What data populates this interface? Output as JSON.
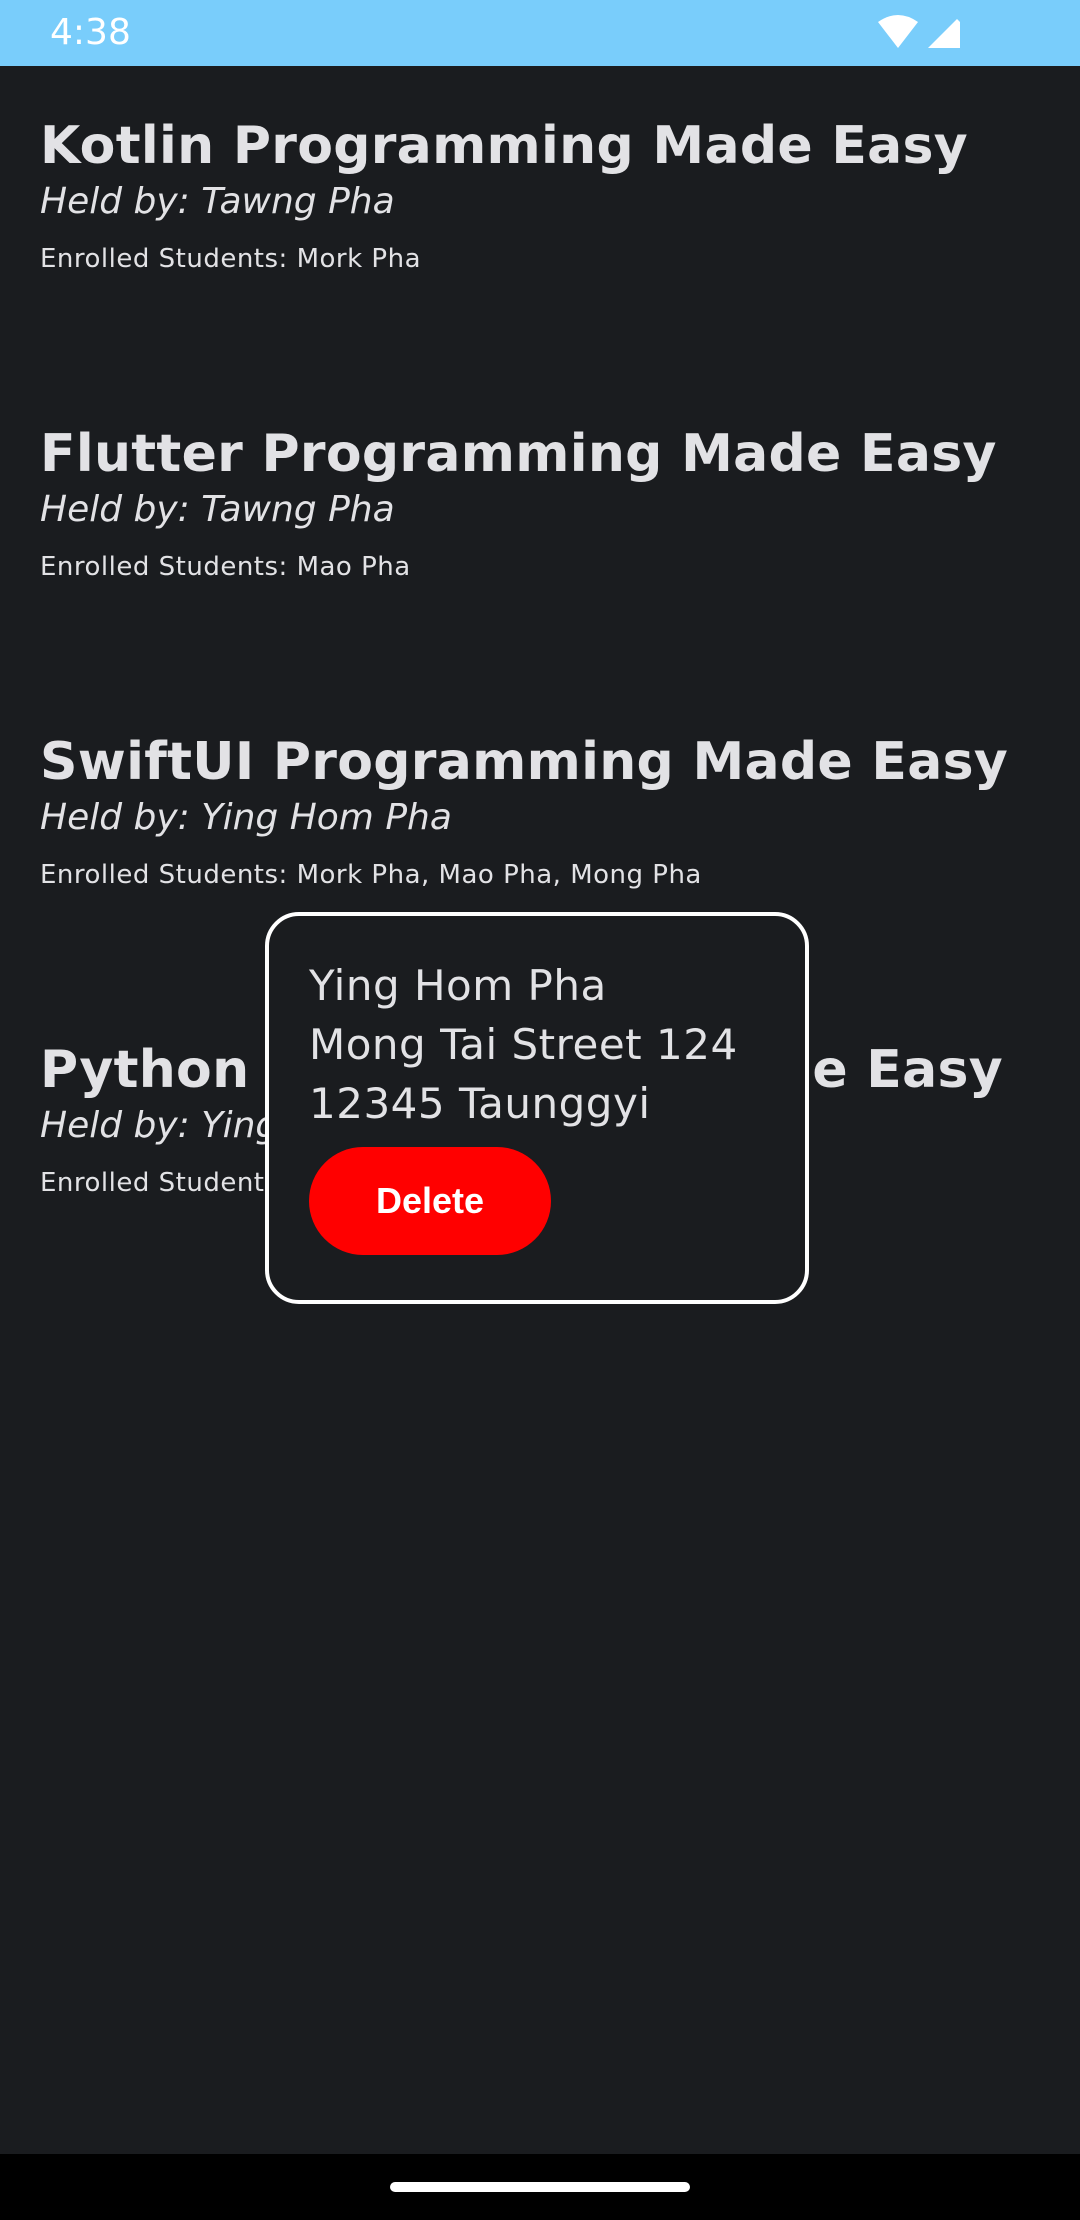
{
  "status_bar": {
    "time": "4:38",
    "wifi_icon": "wifi-icon",
    "signal_icon": "signal-icon",
    "background": "#79cdfb"
  },
  "courses": [
    {
      "title": "Kotlin Programming Made Easy",
      "host": "Held by: Tawng Pha",
      "students": "Enrolled Students: Mork Pha"
    },
    {
      "title": "Flutter Programming Made Easy",
      "host": "Held by: Tawng Pha",
      "students": "Enrolled Students: Mao Pha"
    },
    {
      "title": "SwiftUI Programming Made Easy",
      "host": "Held by: Ying Hom Pha",
      "students": "Enrolled Students: Mork Pha, Mao Pha, Mong Pha"
    },
    {
      "title": "Python Programming Made Easy",
      "host": "Held by: Ying Hom Pha",
      "students": "Enrolled Students"
    }
  ],
  "popup": {
    "name": "Ying Hom Pha",
    "street": "Mong Tai Street 124",
    "city": "12345 Taunggyi",
    "delete_label": "Delete",
    "delete_color": "#ff0000"
  },
  "colors": {
    "background": "#1a1c1f",
    "text": "#e2e2e5",
    "accent": "#79cdfb"
  }
}
